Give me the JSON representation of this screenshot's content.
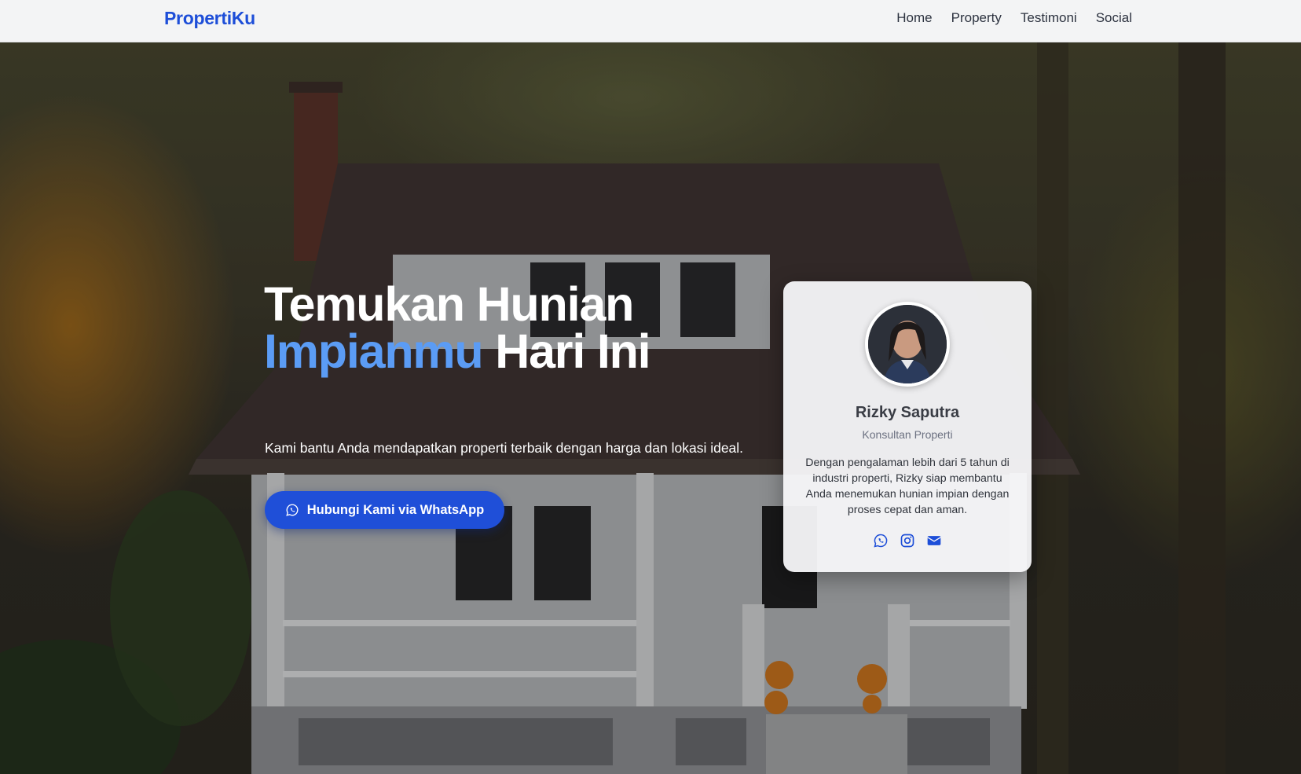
{
  "navbar": {
    "brand": "PropertiKu",
    "links": [
      "Home",
      "Property",
      "Testimoni",
      "Social"
    ]
  },
  "hero": {
    "title_line1": "Temukan Hunian",
    "title_accent": "Impianmu",
    "title_line2_rest": "Hari Ini",
    "subtitle": "Kami bantu Anda mendapatkan properti terbaik dengan harga dan lokasi ideal.",
    "cta_label": "Hubungi Kami via WhatsApp"
  },
  "agent_card": {
    "name": "Rizky Saputra",
    "role": "Konsultan Properti",
    "description": "Dengan pengalaman lebih dari 5 tahun di industri properti, Rizky siap membantu Anda menemukan hunian impian dengan proses cepat dan aman.",
    "socials": [
      "whatsapp-icon",
      "instagram-icon",
      "mail-icon"
    ]
  },
  "colors": {
    "brand": "#1d4ed8",
    "accent_text": "#5b9cf5",
    "cta_bg": "#1f4fd8"
  }
}
